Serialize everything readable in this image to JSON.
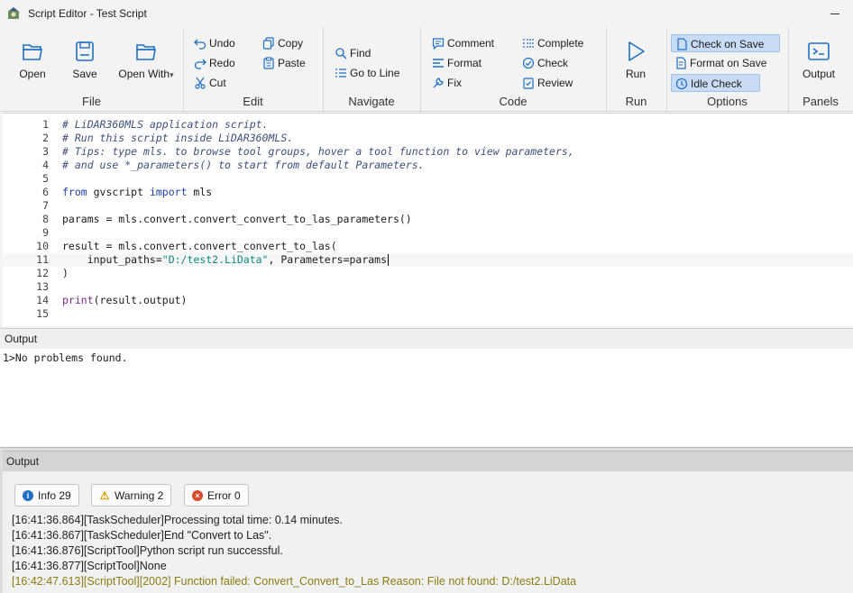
{
  "window": {
    "title": "Script Editor - Test Script"
  },
  "ribbon": {
    "file": {
      "label": "File",
      "open": "Open",
      "save": "Save",
      "open_with": "Open With"
    },
    "edit": {
      "label": "Edit",
      "undo": "Undo",
      "redo": "Redo",
      "cut": "Cut",
      "copy": "Copy",
      "paste": "Paste"
    },
    "navigate": {
      "label": "Navigate",
      "find": "Find",
      "goto": "Go to Line"
    },
    "code": {
      "label": "Code",
      "comment": "Comment",
      "format": "Format",
      "fix": "Fix",
      "complete": "Complete",
      "check": "Check",
      "review": "Review"
    },
    "run": {
      "label": "Run",
      "run": "Run"
    },
    "options": {
      "label": "Options",
      "check_on_save": "Check on Save",
      "format_on_save": "Format on Save",
      "idle_check": "Idle Check"
    },
    "panels": {
      "label": "Panels",
      "output": "Output"
    }
  },
  "editor": {
    "lines": [
      {
        "n": "1",
        "t": "# LiDAR360MLS application script."
      },
      {
        "n": "2",
        "t": "# Run this script inside LiDAR360MLS."
      },
      {
        "n": "3",
        "t": "# Tips: type mls. to browse tool groups, hover a tool function to view parameters,"
      },
      {
        "n": "4",
        "t": "# and use *_parameters() to start from default Parameters."
      },
      {
        "n": "5",
        "t": ""
      },
      {
        "n": "6",
        "t": "from gvscript import mls"
      },
      {
        "n": "7",
        "t": ""
      },
      {
        "n": "8",
        "t": "params = mls.convert.convert_convert_to_las_parameters()"
      },
      {
        "n": "9",
        "t": ""
      },
      {
        "n": "10",
        "t": "result = mls.convert.convert_convert_to_las("
      },
      {
        "n": "11",
        "t": "    input_paths=\"D:/test2.LiData\", Parameters=params"
      },
      {
        "n": "12",
        "t": ")"
      },
      {
        "n": "13",
        "t": ""
      },
      {
        "n": "14",
        "t": "print(result.output)"
      },
      {
        "n": "15",
        "t": ""
      }
    ]
  },
  "output_panel": {
    "title": "Output",
    "text": "1>No problems found."
  },
  "output_panel2": {
    "title": "Output",
    "filters": {
      "info": "Info 29",
      "warning": "Warning 2",
      "error": "Error 0"
    },
    "log": [
      "[16:41:36.864][TaskScheduler]Processing total time: 0.14 minutes.",
      "[16:41:36.867][TaskScheduler]End \"Convert to Las\".",
      "[16:41:36.876][ScriptTool]Python script run successful.",
      "[16:41:36.877][ScriptTool]None",
      "[16:42:47.613][ScriptTool][2002] Function failed: Convert_Convert_to_Las Reason: File not found: D:/test2.LiData"
    ]
  },
  "colors": {
    "accent": "#1f6fc4",
    "active_bg": "#c8dcf5",
    "error_text": "#8a7d12"
  }
}
